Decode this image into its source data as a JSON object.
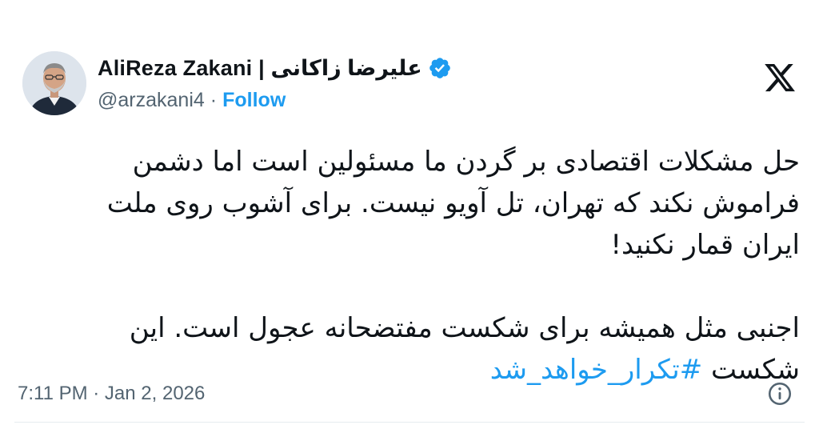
{
  "author": {
    "display_name": "AliReza Zakani | علیرضا زاکانی",
    "handle": "@arzakani4",
    "separator": "·",
    "follow_label": "Follow",
    "verified": true
  },
  "tweet": {
    "paragraph1": "حل مشکلات اقتصادی بر گردن ما مسئولین است اما دشمن فراموش نکند که تهران، تل آویو نیست. برای آشوب روی ملت ایران قمار نکنید!",
    "paragraph2_text": "اجنبی مثل همیشه برای شکست مفتضحانه عجول است. این شکست ",
    "hashtag": "#تکرار_خواهد_شد"
  },
  "footer": {
    "timestamp": "7:11 PM · Jan 2, 2026"
  },
  "icons": {
    "platform": "x-logo-icon",
    "verified": "verified-badge-icon",
    "info": "info-icon"
  },
  "colors": {
    "accent": "#1d9bf0",
    "text": "#0f1419",
    "muted": "#536471"
  }
}
